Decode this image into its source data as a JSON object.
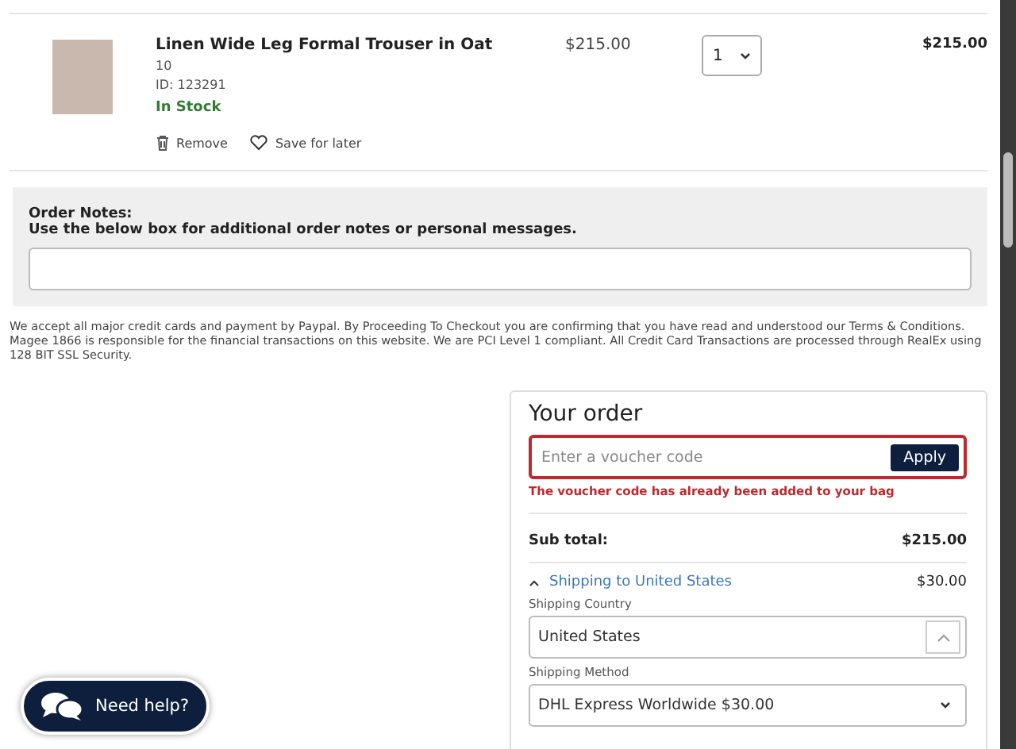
{
  "cart_item": {
    "name": "Linen Wide Leg Formal Trouser in Oat",
    "size": "10",
    "id": "ID: 123291",
    "stock": "In Stock",
    "price": "$215.00",
    "quantity": "1",
    "total": "$215.00",
    "actions": [
      "Remove",
      "Save for later"
    ]
  },
  "order_notes": {
    "title": "Order Notes:",
    "hint": "Use the below box for additional order notes or personal messages."
  },
  "legal_text": "We accept all major credit cards and payment by Paypal. By Proceeding To Checkout you are confirming that you have read and understood our Terms & Conditions. Magee 1866 is responsible for the financial transactions on this website. We are PCI Level 1 compliant. All Credit Card Transactions are processed through RealEx using 128 BIT SSL Security.",
  "order": {
    "title": "Your order",
    "voucher": {
      "placeholder": "Enter a voucher code",
      "button": "Apply",
      "invalid": true,
      "error": "The voucher code has already been added to your bag"
    },
    "subtotal_label": "Sub total:",
    "subtotal": "$215.00",
    "shipping": {
      "label": "Shipping to United States",
      "amount": "$30.00",
      "expanded": true,
      "country_label": "Shipping Country",
      "country": "United States",
      "method_label": "Shipping Method",
      "method": "DHL Express Worldwide $30.00"
    }
  },
  "help_button": "Need help?"
}
